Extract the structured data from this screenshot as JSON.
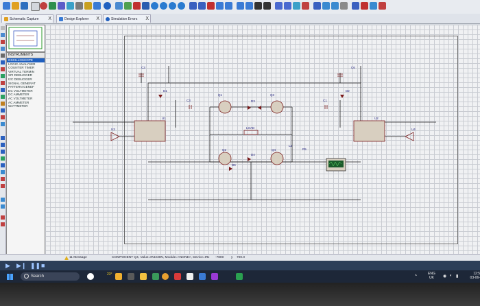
{
  "tabs": [
    {
      "label": "Schematic Capture",
      "close": "X"
    },
    {
      "label": "Design Explorer",
      "close": "X"
    },
    {
      "label": "Simulation Errors",
      "close": "X"
    }
  ],
  "instruments": {
    "header": "INSTRUMENTS",
    "items": [
      "OSCILLOSCOPE",
      "LOGIC ANALYSER",
      "COUNTER TIMER",
      "VIRTUAL TERMIN",
      "SPI DEBUGGER",
      "I2C DEBUGGER",
      "SIGNAL GENERAT",
      "PATTERN GENEF",
      "DC VOLTMETER",
      "DC AMMETER",
      "AC VOLTMETER",
      "AC AMMETER",
      "WATTMETER"
    ],
    "selected_index": 0
  },
  "schematic": {
    "labels": [
      "C3",
      "C1",
      "D1",
      "Q1",
      "Q3",
      "D3",
      "D2",
      "C6",
      "C4",
      "U1",
      "U2",
      "U3",
      "U4",
      "LOAD",
      "Q2",
      "Q4",
      "D4",
      "D6",
      "R5",
      "L2"
    ]
  },
  "status": {
    "messages": "11 Message",
    "component": "COMPONENT Q4, Value=IRJ230N, Module=<NONE>, Device=IR",
    "x_label": "x",
    "coord_x": "-7800",
    "y_label": "y",
    "coord_y": "700.0"
  },
  "taskbar": {
    "search_placeholder": "Search",
    "weather": "23°",
    "lang_top": "ENG",
    "lang_bottom": "UK",
    "time": "12:5",
    "date": "03-06-"
  },
  "colors": {
    "selected": "#1f5fbf",
    "taskbar": "#1d2738",
    "wire": "#1a1a1a",
    "component": "#7a1a1a"
  }
}
